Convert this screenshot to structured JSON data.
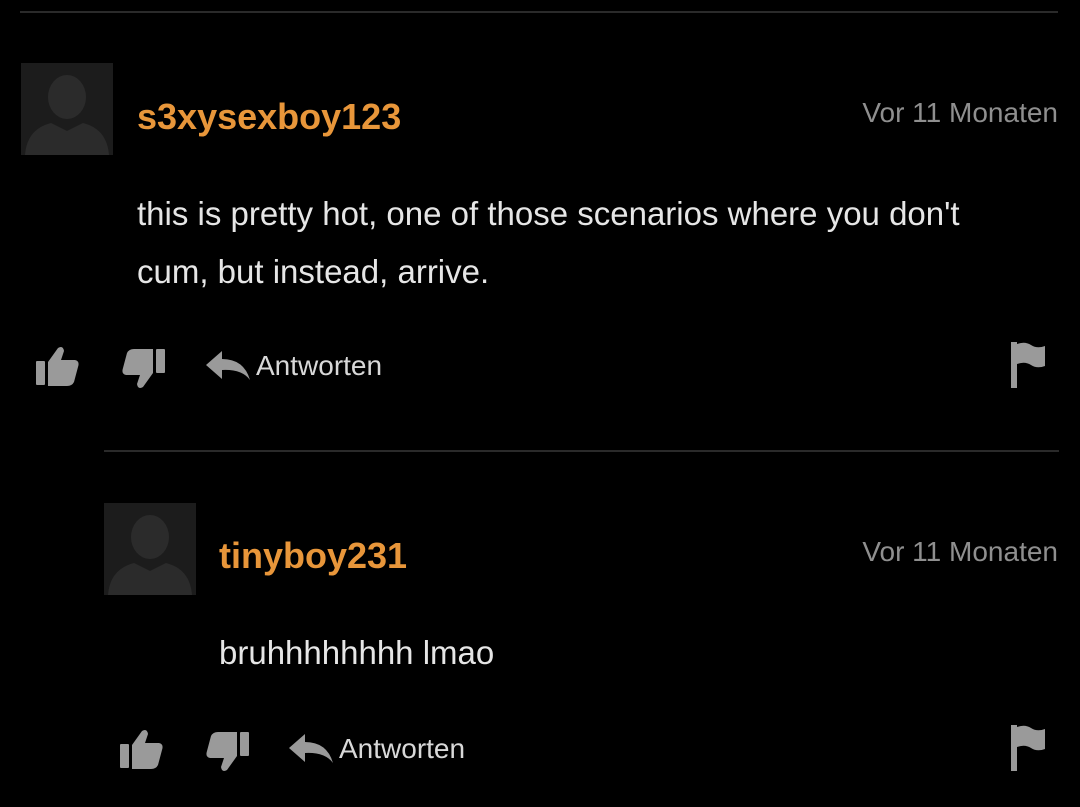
{
  "colors": {
    "background": "#000000",
    "username": "#e8963a",
    "timestamp": "#8f8f8f",
    "body_text": "#e6e6e6",
    "icon": "#9a9a9a"
  },
  "comments": [
    {
      "username": "s3xysexboy123",
      "timestamp": "Vor 11 Monaten",
      "text": "this is pretty hot, one of those scenarios where you don't cum, but instead, arrive.",
      "reply_label": "Antworten",
      "icons": [
        "thumbs-up-icon",
        "thumbs-down-icon",
        "reply-arrow-icon",
        "flag-icon"
      ]
    },
    {
      "username": "tinyboy231",
      "timestamp": "Vor 11 Monaten",
      "text": "bruhhhhhhhh lmao",
      "reply_label": "Antworten",
      "icons": [
        "thumbs-up-icon",
        "thumbs-down-icon",
        "reply-arrow-icon",
        "flag-icon"
      ]
    }
  ]
}
